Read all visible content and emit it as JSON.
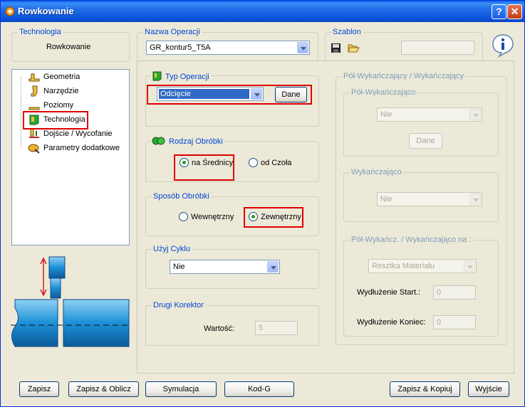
{
  "window": {
    "title": "Rowkowanie"
  },
  "technologia": {
    "label": "Technologia",
    "value": "Rowkowanie"
  },
  "nazwa_operacji": {
    "label": "Nazwa Operacji",
    "value": "GR_kontur5_T5A"
  },
  "szablon": {
    "label": "Szablon",
    "value": ""
  },
  "tree": {
    "items": [
      {
        "label": "Geometria",
        "icon": "geometry-icon"
      },
      {
        "label": "Narzędzie",
        "icon": "tool-icon"
      },
      {
        "label": "Poziomy",
        "icon": "levels-icon"
      },
      {
        "label": "Technologia",
        "icon": "technology-icon"
      },
      {
        "label": "Dojście / Wycofanie",
        "icon": "approach-icon"
      },
      {
        "label": "Parametry dodatkowe",
        "icon": "parameters-icon"
      }
    ]
  },
  "typ_operacji": {
    "label": "Typ Operacji",
    "value": "Odcięcie",
    "button": "Dane"
  },
  "rodzaj_obrobki": {
    "label": "Rodzaj Obróbki",
    "options": [
      "na Średnicy",
      "od Czoła"
    ],
    "selected": 0
  },
  "sposob_obrobki": {
    "label": "Sposób Obróbki",
    "options": [
      "Wewnętrzny",
      "Zewnętrzny"
    ],
    "selected": 1
  },
  "uzyj_cyklu": {
    "label": "Użyj Cyklu",
    "value": "Nie"
  },
  "drugi_korektor": {
    "label": "Drugi Korektor",
    "field_label": "Wartość:",
    "value": "5"
  },
  "polwykanczajaco": {
    "title": "Pół-Wykańczający / Wykańczający",
    "pol": {
      "label": "Pół-Wykańczająco",
      "value": "Nie",
      "button": "Dane"
    },
    "wyk": {
      "label": "Wykańczająco",
      "value": "Nie"
    },
    "na": {
      "label": "Pół-Wykańcz. / Wykańczająco  na :",
      "value": "Resztka Materiału",
      "start_label": "Wydłużenie Start.:",
      "start_value": "0",
      "end_label": "Wydłużenie Koniec:",
      "end_value": "0"
    }
  },
  "buttons": {
    "zapisz": "Zapisz",
    "zapisz_oblicz": "Zapisz & Oblicz",
    "symulacja": "Symulacja",
    "kod_g": "Kod-G",
    "zapisz_kopiuj": "Zapisz & Kopiuj",
    "wyjscie": "Wyjście"
  },
  "colors": {
    "accent": "#0046d5",
    "titlebar": "#0a5fe8",
    "highlight": "#e00000",
    "tool": "#1c8fd6"
  }
}
